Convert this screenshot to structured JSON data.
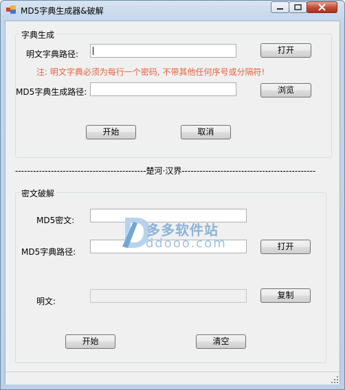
{
  "window": {
    "title": "MD5字典生成器&破解"
  },
  "dict_gen": {
    "group_label": "字典生成",
    "plain_path_label": "明文字典路径:",
    "plain_path_value": "",
    "open_button": "打开",
    "warning": "注: 明文字典必须为每行一个密码, 不带其他任何序号或分隔符!",
    "md5_path_label": "MD5字典生成路径:",
    "md5_path_value": "",
    "browse_button": "浏览",
    "start_button": "开始",
    "cancel_button": "取消"
  },
  "divider": {
    "text": "--------------------------------------------楚河·汉界---------------------------------------------"
  },
  "crack": {
    "group_label": "密文破解",
    "md5_cipher_label": "MD5密文:",
    "md5_cipher_value": "",
    "md5_dict_label": "MD5字典路径:",
    "md5_dict_value": "",
    "open_button": "打开",
    "plain_label": "明文:",
    "plain_value": "",
    "copy_button": "复制",
    "start_button": "开始",
    "clear_button": "清空"
  },
  "watermark": {
    "text1": "多多软件站",
    "text2": "ddooo.com"
  },
  "colors": {
    "warning": "#e8613c",
    "title_bar": "#c3d5ea"
  }
}
